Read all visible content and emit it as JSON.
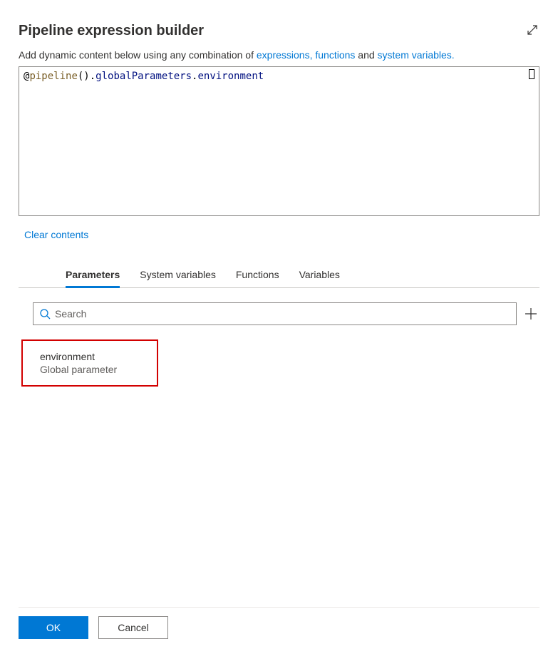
{
  "header": {
    "title": "Pipeline expression builder"
  },
  "subtitle": {
    "prefix": "Add dynamic content below using any combination of ",
    "link1": "expressions,",
    "link2": "functions",
    "mid": " and ",
    "link3": "system variables."
  },
  "editor": {
    "at": "@",
    "fn": "pipeline",
    "parens": "().",
    "prop1": "globalParameters",
    "dot": ".",
    "prop2": "environment"
  },
  "clear_label": "Clear contents",
  "tabs": {
    "parameters": "Parameters",
    "system_variables": "System variables",
    "functions": "Functions",
    "variables": "Variables"
  },
  "search": {
    "placeholder": "Search"
  },
  "items": [
    {
      "name": "environment",
      "subtitle": "Global parameter"
    }
  ],
  "footer": {
    "ok": "OK",
    "cancel": "Cancel"
  }
}
